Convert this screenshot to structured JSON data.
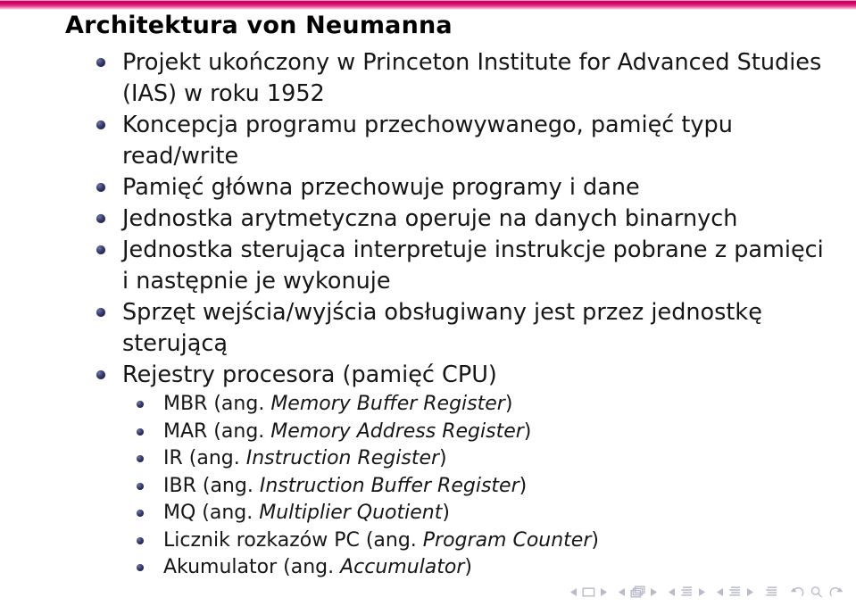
{
  "slide": {
    "title": "Architektura von Neumanna",
    "accent_color": "#d4006a",
    "bullet_color": "#2a2f5e",
    "text_color": "#161616",
    "background_color": "#ffffff"
  },
  "bullets": [
    {
      "text": "Projekt ukończony w Princeton Institute for Advanced Studies (IAS) w roku 1952"
    },
    {
      "text": "Koncepcja programu przechowywanego, pamięć typu read/write"
    },
    {
      "text": "Pamięć główna przechowuje programy i dane"
    },
    {
      "text": "Jednostka arytmetyczna operuje na danych binarnych"
    },
    {
      "text": "Jednostka sterująca interpretuje instrukcje pobrane z pamięci i następnie je wykonuje"
    },
    {
      "text": "Sprzęt wejścia/wyjścia obsługiwany jest przez jednostkę sterującą"
    },
    {
      "text": "Rejestry procesora (pamięć CPU)"
    }
  ],
  "subbullets": [
    {
      "pl": "MBR (ang. ",
      "en": "Memory Buffer Register",
      "tail": ")"
    },
    {
      "pl": "MAR (ang. ",
      "en": "Memory Address Register",
      "tail": ")"
    },
    {
      "pl": "IR (ang. ",
      "en": "Instruction Register",
      "tail": ")"
    },
    {
      "pl": "IBR (ang. ",
      "en": "Instruction Buffer Register",
      "tail": ")"
    },
    {
      "pl": "MQ (ang. ",
      "en": "Multiplier Quotient",
      "tail": ")"
    },
    {
      "pl": "Licznik rozkazów PC (ang. ",
      "en": "Program Counter",
      "tail": ")"
    },
    {
      "pl": "Akumulator (ang. ",
      "en": "Accumulator",
      "tail": ")"
    }
  ],
  "navigation": {
    "color": "#b9bbc9",
    "groups": [
      {
        "name": "slide",
        "icon": "slide-icon",
        "prev": "◂",
        "next": "▸"
      },
      {
        "name": "frame",
        "icon": "frame-stack-icon",
        "prev": "◂",
        "next": "▸"
      },
      {
        "name": "subsection",
        "icon": "subsection-icon",
        "prev": "◂",
        "next": "▸"
      },
      {
        "name": "section",
        "icon": "section-icon",
        "prev": "◂",
        "next": "▸"
      },
      {
        "name": "presentation",
        "icon": "document-icon"
      },
      {
        "name": "back",
        "icon": "back-arrow-icon"
      },
      {
        "name": "find",
        "icon": "search-icon"
      },
      {
        "name": "forward",
        "icon": "forward-arrow-icon"
      }
    ]
  }
}
